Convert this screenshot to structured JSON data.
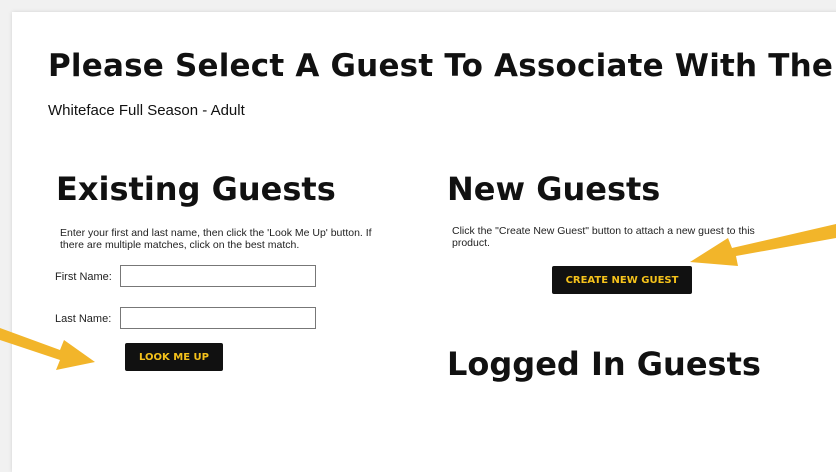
{
  "page": {
    "title": "Please Select A Guest To Associate With The",
    "product_name": "Whiteface Full Season - Adult"
  },
  "existing": {
    "heading": "Existing Guests",
    "instructions": "Enter your first and last name, then click the 'Look Me Up' button. If there are multiple matches, click on the best match.",
    "first_name_label": "First Name:",
    "first_name_value": "",
    "last_name_label": "Last Name:",
    "last_name_value": "",
    "lookup_button": "LOOK ME UP"
  },
  "new": {
    "heading": "New Guests",
    "instructions": "Click the \"Create New Guest\" button to attach a new guest to this product.",
    "create_button": "CREATE NEW GUEST"
  },
  "logged_in": {
    "heading": "Logged In Guests"
  },
  "colors": {
    "button_bg": "#111111",
    "button_text": "#f5c21b",
    "arrow": "#f2b52a"
  }
}
